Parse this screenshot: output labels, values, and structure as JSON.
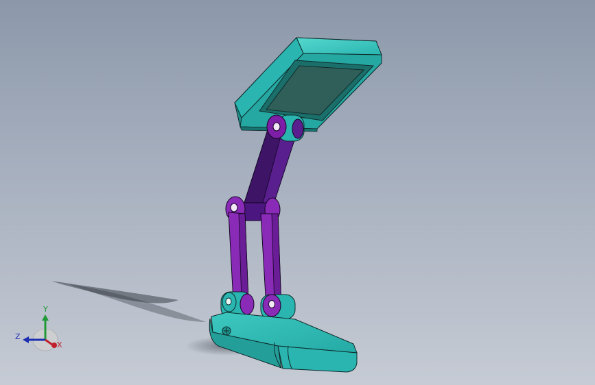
{
  "viewport": {
    "background_top": "#8c98aa",
    "background_bottom": "#c6cbd4"
  },
  "model": {
    "parts": [
      "lamp-head",
      "upper-arm-link",
      "middle-joint",
      "lower-arm-link-left",
      "lower-arm-link-right",
      "base"
    ],
    "colors": {
      "teal": "#2ab5b0",
      "teal_dark": "#1a7f7c",
      "lens": "#2f5f58",
      "purple_dark": "#3d1466",
      "purple": "#7d1fa6",
      "purple_light": "#a13ad1",
      "outline": "#0e2a2a"
    }
  },
  "triad": {
    "x_label": "X",
    "y_label": "Y",
    "z_label": "Z",
    "x_color": "#c0202c",
    "y_color": "#1f9a36",
    "z_color": "#1c2fb0"
  }
}
